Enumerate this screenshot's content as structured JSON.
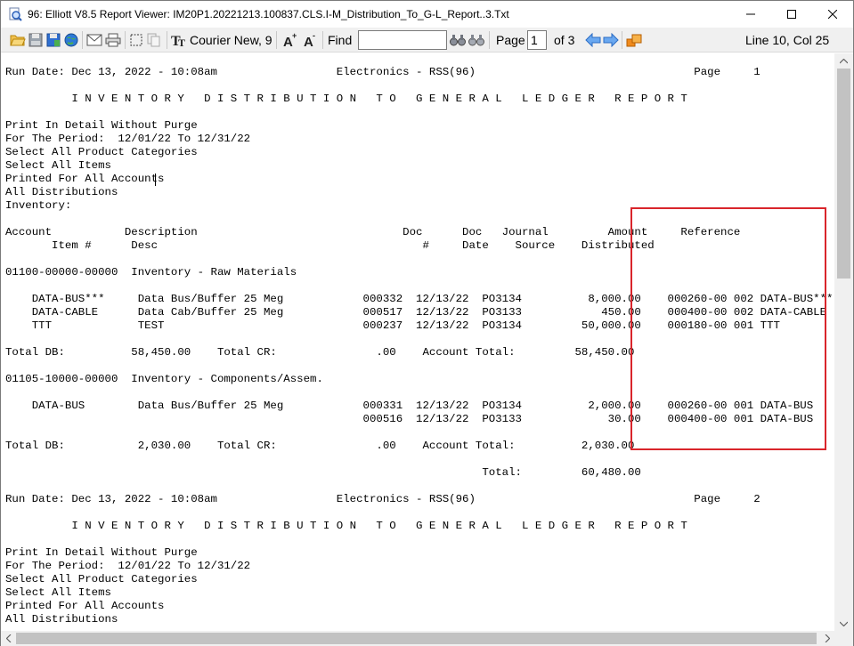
{
  "window": {
    "title": "96: Elliott V8.5 Report Viewer: IM20P1.20221213.100837.CLS.I-M_Distribution_To_G-L_Report..3.Txt"
  },
  "toolbar": {
    "icons": [
      "open-icon",
      "save-icon",
      "save-as-icon",
      "globe-icon",
      "email-icon",
      "print-icon",
      "select-icon",
      "copy-icon",
      "font-icon",
      "increase-font-icon",
      "decrease-font-icon",
      "find-next-icon",
      "find-prev-icon",
      "prev-page-icon",
      "next-page-icon",
      "export-icon"
    ],
    "font_label": "Courier New, 9",
    "find_label": "Find",
    "find_value": "",
    "page_label": "Page",
    "page_value": "1",
    "page_total": "of 3",
    "cursor_pos": "Line 10, Col 25"
  },
  "report": {
    "lines": [
      "Run Date: Dec 13, 2022 - 10:08am                  Electronics - RSS(96)                                 Page     1",
      "",
      "          I N V E N T O R Y   D I S T R I B U T I O N   T O   G E N E R A L   L E D G E R   R E P O R T",
      "",
      "Print In Detail Without Purge",
      "For The Period:  12/01/22 To 12/31/22",
      "Select All Product Categories",
      "Select All Items",
      "Printed For All Accounts",
      "All Distributions",
      "Inventory:",
      "",
      "Account           Description                               Doc      Doc   Journal         Amount     Reference",
      "       Item #      Desc                                        #     Date    Source    Distributed",
      "",
      "01100-00000-00000  Inventory - Raw Materials",
      "",
      "    DATA-BUS***     Data Bus/Buffer 25 Meg            000332  12/13/22  PO3134          8,000.00    000260-00 002 DATA-BUS***",
      "    DATA-CABLE      Data Cab/Buffer 25 Meg            000517  12/13/22  PO3133            450.00    000400-00 002 DATA-CABLE",
      "    TTT             TEST                              000237  12/13/22  PO3134         50,000.00    000180-00 001 TTT",
      "",
      "Total DB:          58,450.00    Total CR:               .00    Account Total:         58,450.00",
      "",
      "01105-10000-00000  Inventory - Components/Assem.",
      "",
      "    DATA-BUS        Data Bus/Buffer 25 Meg            000331  12/13/22  PO3134          2,000.00    000260-00 001 DATA-BUS",
      "                                                      000516  12/13/22  PO3133             30.00    000400-00 001 DATA-BUS",
      "",
      "Total DB:           2,030.00    Total CR:               .00    Account Total:          2,030.00",
      "",
      "                                                                        Total:         60,480.00",
      "",
      "Run Date: Dec 13, 2022 - 10:08am                  Electronics - RSS(96)                                 Page     2",
      "",
      "          I N V E N T O R Y   D I S T R I B U T I O N   T O   G E N E R A L   L E D G E R   R E P O R T",
      "",
      "Print In Detail Without Purge",
      "For The Period:  12/01/22 To 12/31/22",
      "Select All Product Categories",
      "Select All Items",
      "Printed For All Accounts",
      "All Distributions"
    ]
  },
  "colors": {
    "highlight": "#d9252b",
    "toolbar_bg": "#f0f0f0"
  }
}
